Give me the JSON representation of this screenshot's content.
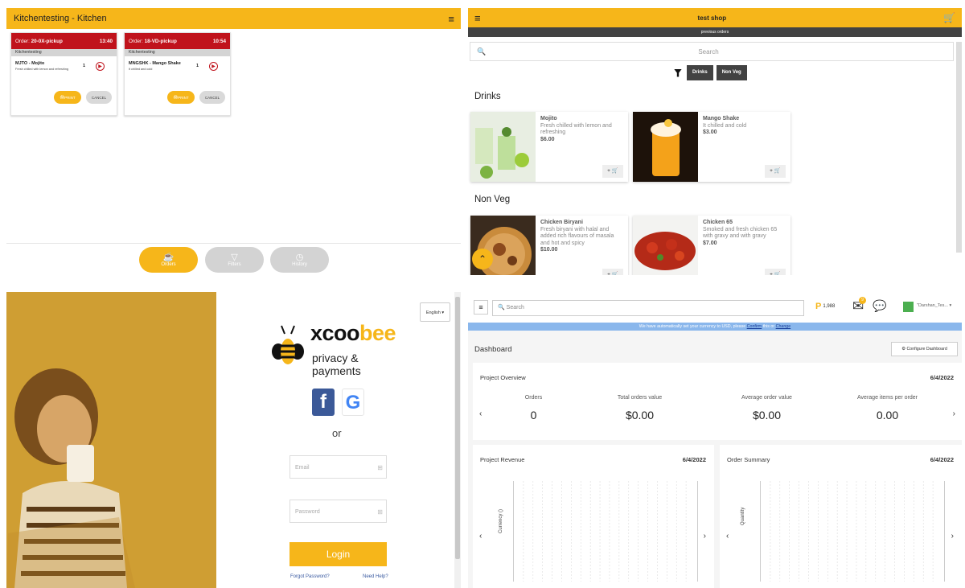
{
  "kitchen": {
    "title": "Kitchentesting - Kitchen",
    "orders": [
      {
        "order_prefix": "Order:",
        "order_id": "20-0X-pickup",
        "time": "13:40",
        "location": "Kitchentesting",
        "item": "MJTO - Mojito",
        "desc": "Fresh chilled with lemon and refreshing",
        "qty": "1",
        "print_label": "PRINT",
        "cancel_label": "CANCEL"
      },
      {
        "order_prefix": "Order:",
        "order_id": "18-VD-pickup",
        "time": "10:54",
        "location": "Kitchentesting",
        "item": "MNGSHK - Mango Shake",
        "desc": "It chilled and cold",
        "qty": "1",
        "print_label": "PRINT",
        "cancel_label": "CANCEL"
      }
    ],
    "nav": [
      {
        "label": "Orders",
        "icon": "cup-icon",
        "active": true
      },
      {
        "label": "Filters",
        "icon": "filter-icon",
        "active": false
      },
      {
        "label": "History",
        "icon": "clock-icon",
        "active": false
      }
    ]
  },
  "shop": {
    "title": "test shop",
    "previous_orders": "previous orders",
    "search_placeholder": "Search",
    "filters": [
      "Drinks",
      "Non Veg"
    ],
    "categories": [
      {
        "name": "Drinks",
        "products": [
          {
            "name": "Mojito",
            "desc": "Fresh chilled with lemon and refreshing",
            "price": "$6.00"
          },
          {
            "name": "Mango Shake",
            "desc": "It chilled and cold",
            "price": "$3.00"
          }
        ]
      },
      {
        "name": "Non Veg",
        "products": [
          {
            "name": "Chicken Biryani",
            "desc": "Fresh biryani with halal and added rich flavours of masala and hot and spicy",
            "price": "$10.00"
          },
          {
            "name": "Chicken 65",
            "desc": "Smoked and fresh chicken 65 with gravy and with gravy",
            "price": "$7.00"
          }
        ]
      }
    ],
    "add_label": "+ 🛒"
  },
  "login": {
    "language": "English",
    "logo_a": "xcoo",
    "logo_b": "bee",
    "logo_sub": "privacy & payments",
    "or_text": "or",
    "email_placeholder": "Email",
    "password_placeholder": "Password",
    "login_label": "Login",
    "forgot_label": "Forgot Password?",
    "help_label": "Need Help?"
  },
  "dashboard": {
    "search_placeholder": "Search",
    "points": "1,988",
    "mail_badge": "9",
    "user": "\"Darshan_Tes...",
    "banner_pre": "We have automatically set your currency to USD, please",
    "banner_confirm": "Confirm",
    "banner_mid": "this or",
    "banner_change": "Change",
    "title": "Dashboard",
    "configure": "Configure Dashboard",
    "overview": {
      "title": "Project Overview",
      "date": "6/4/2022",
      "kpis": [
        {
          "label": "Orders",
          "value": "0"
        },
        {
          "label": "Total orders value",
          "value": "$0.00"
        },
        {
          "label": "Average order value",
          "value": "$0.00"
        },
        {
          "label": "Average items per order",
          "value": "0.00"
        }
      ]
    },
    "revenue": {
      "title": "Project Revenue",
      "date": "6/4/2022",
      "ylabel": "Currency ()"
    },
    "summary": {
      "title": "Order Summary",
      "date": "6/4/2022",
      "ylabel": "Quantity"
    }
  }
}
